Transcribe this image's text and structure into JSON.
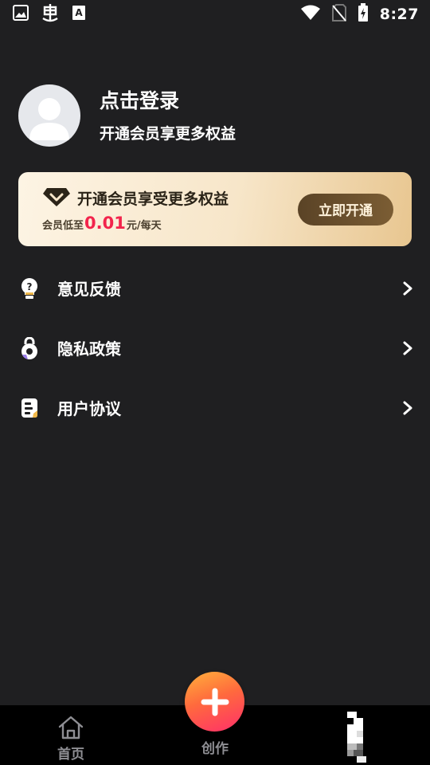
{
  "status_bar": {
    "time": "8:27",
    "left_icons": [
      "image-icon",
      "bug-icon",
      "keyboard-a-icon"
    ],
    "right_icons": [
      "wifi-icon",
      "no-sim-icon",
      "battery-charging-icon"
    ]
  },
  "profile": {
    "title": "点击登录",
    "subtitle": "开通会员享更多权益"
  },
  "vip_banner": {
    "title": "开通会员享受更多权益",
    "price_prefix": "会员低至",
    "price": "0.01",
    "price_suffix": "元/每天",
    "button_label": "立即开通",
    "price_color": "#f2244c"
  },
  "menu": {
    "items": [
      {
        "label": "意见反馈",
        "icon": "lightbulb-question-icon"
      },
      {
        "label": "隐私政策",
        "icon": "privacy-lock-icon"
      },
      {
        "label": "用户协议",
        "icon": "document-icon"
      }
    ]
  },
  "bottom_nav": {
    "home_label": "首页",
    "create_label": "创作"
  },
  "colors": {
    "background": "#1f1f21",
    "nav_background": "#000000",
    "fab_gradient": [
      "#ffb13b",
      "#ff2f6a"
    ]
  }
}
